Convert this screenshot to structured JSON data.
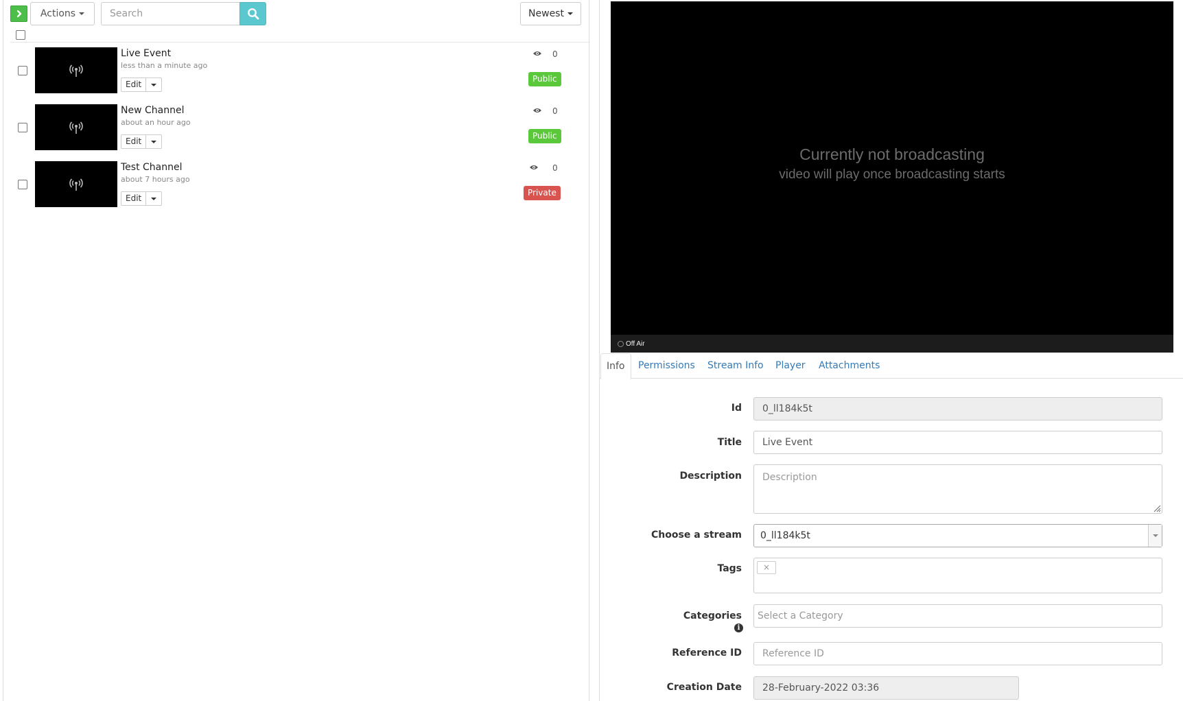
{
  "toolbar": {
    "actions_label": "Actions",
    "search_placeholder": "Search",
    "sort_label": "Newest"
  },
  "entries": [
    {
      "title": "Live Event",
      "time": "less than a minute ago",
      "edit_label": "Edit",
      "views": "0",
      "status": "Public"
    },
    {
      "title": "New Channel",
      "time": "about an hour ago",
      "edit_label": "Edit",
      "views": "0",
      "status": "Public"
    },
    {
      "title": "Test Channel",
      "time": "about 7 hours ago",
      "edit_label": "Edit",
      "views": "0",
      "status": "Private"
    }
  ],
  "player": {
    "title": "Currently not broadcasting",
    "subtitle": "video will play once broadcasting starts",
    "status": "Off Air"
  },
  "tabs": [
    "Info",
    "Permissions",
    "Stream Info",
    "Player",
    "Attachments"
  ],
  "form": {
    "id_label": "Id",
    "id_value": "0_ll184k5t",
    "title_label": "Title",
    "title_value": "Live Event",
    "description_label": "Description",
    "description_placeholder": "Description",
    "stream_label": "Choose a stream",
    "stream_value": "0_ll184k5t",
    "tags_label": "Tags",
    "tag_remove": "×",
    "categories_label": "Categories",
    "categories_placeholder": "Select a Category",
    "reference_label": "Reference ID",
    "reference_placeholder": "Reference ID",
    "creation_label": "Creation Date",
    "creation_value": "28-February-2022 03:36"
  },
  "colors": {
    "public": "#5ac83a",
    "private": "#d9534f",
    "link": "#337ab7",
    "search_button": "#5bc8d0",
    "go_button": "#4cbf4a"
  },
  "icons": {
    "go": "chevron-right-icon",
    "search": "search-icon",
    "thumbnail": "broadcast-icon",
    "views": "eye-icon",
    "info": "info-icon"
  }
}
